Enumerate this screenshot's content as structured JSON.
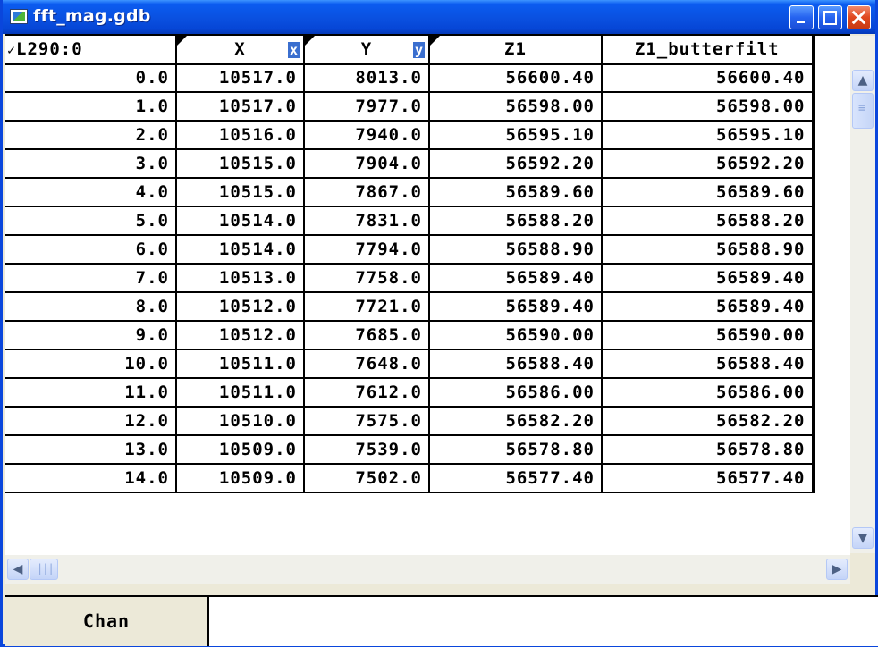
{
  "window": {
    "title": "fft_mag.gdb",
    "icons": {
      "app": "database-icon",
      "minimize": "minimize-icon",
      "maximize": "maximize-icon",
      "close": "close-icon"
    }
  },
  "table": {
    "columns": [
      {
        "label": "L290:0",
        "marker": "✓"
      },
      {
        "label": "X",
        "badge": "x"
      },
      {
        "label": "Y",
        "badge": "y"
      },
      {
        "label": "Z1"
      },
      {
        "label": "Z1_butterfilt"
      }
    ],
    "rows": [
      [
        "0.0",
        "10517.0",
        "8013.0",
        "56600.40",
        "56600.40"
      ],
      [
        "1.0",
        "10517.0",
        "7977.0",
        "56598.00",
        "56598.00"
      ],
      [
        "2.0",
        "10516.0",
        "7940.0",
        "56595.10",
        "56595.10"
      ],
      [
        "3.0",
        "10515.0",
        "7904.0",
        "56592.20",
        "56592.20"
      ],
      [
        "4.0",
        "10515.0",
        "7867.0",
        "56589.60",
        "56589.60"
      ],
      [
        "5.0",
        "10514.0",
        "7831.0",
        "56588.20",
        "56588.20"
      ],
      [
        "6.0",
        "10514.0",
        "7794.0",
        "56588.90",
        "56588.90"
      ],
      [
        "7.0",
        "10513.0",
        "7758.0",
        "56589.40",
        "56589.40"
      ],
      [
        "8.0",
        "10512.0",
        "7721.0",
        "56589.40",
        "56589.40"
      ],
      [
        "9.0",
        "10512.0",
        "7685.0",
        "56590.00",
        "56590.00"
      ],
      [
        "10.0",
        "10511.0",
        "7648.0",
        "56588.40",
        "56588.40"
      ],
      [
        "11.0",
        "10511.0",
        "7612.0",
        "56586.00",
        "56586.00"
      ],
      [
        "12.0",
        "10510.0",
        "7575.0",
        "56582.20",
        "56582.20"
      ],
      [
        "13.0",
        "10509.0",
        "7539.0",
        "56578.80",
        "56578.80"
      ],
      [
        "14.0",
        "10509.0",
        "7502.0",
        "56577.40",
        "56577.40"
      ]
    ]
  },
  "scrollbars": {
    "up": "▲",
    "down": "▼",
    "left": "◀",
    "right": "▶"
  },
  "status": {
    "label": "Chan",
    "value": ""
  },
  "colors": {
    "titlebar": "#0a50e0",
    "selection_badge": "#3b6fcf",
    "window_bg": "#ece9d8"
  }
}
